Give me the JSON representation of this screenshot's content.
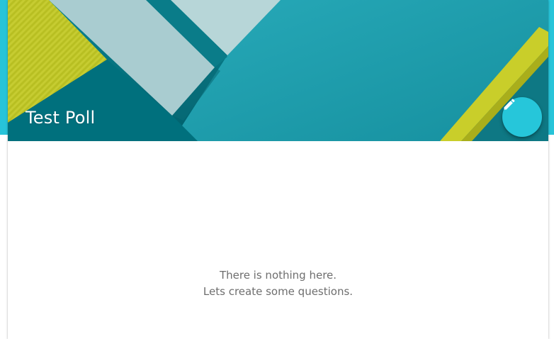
{
  "poll": {
    "title": "Test Poll"
  },
  "header": {
    "edit_icon": "pencil-icon",
    "colors": {
      "accent": "#27c4d9",
      "teal_dark": "#00727f",
      "teal": "#1e9fae",
      "paper_light": "#a9cdd0",
      "yellow": "#c5cc2c"
    }
  },
  "empty_state": {
    "line1": "There is nothing here.",
    "line2": "Lets create some questions."
  }
}
